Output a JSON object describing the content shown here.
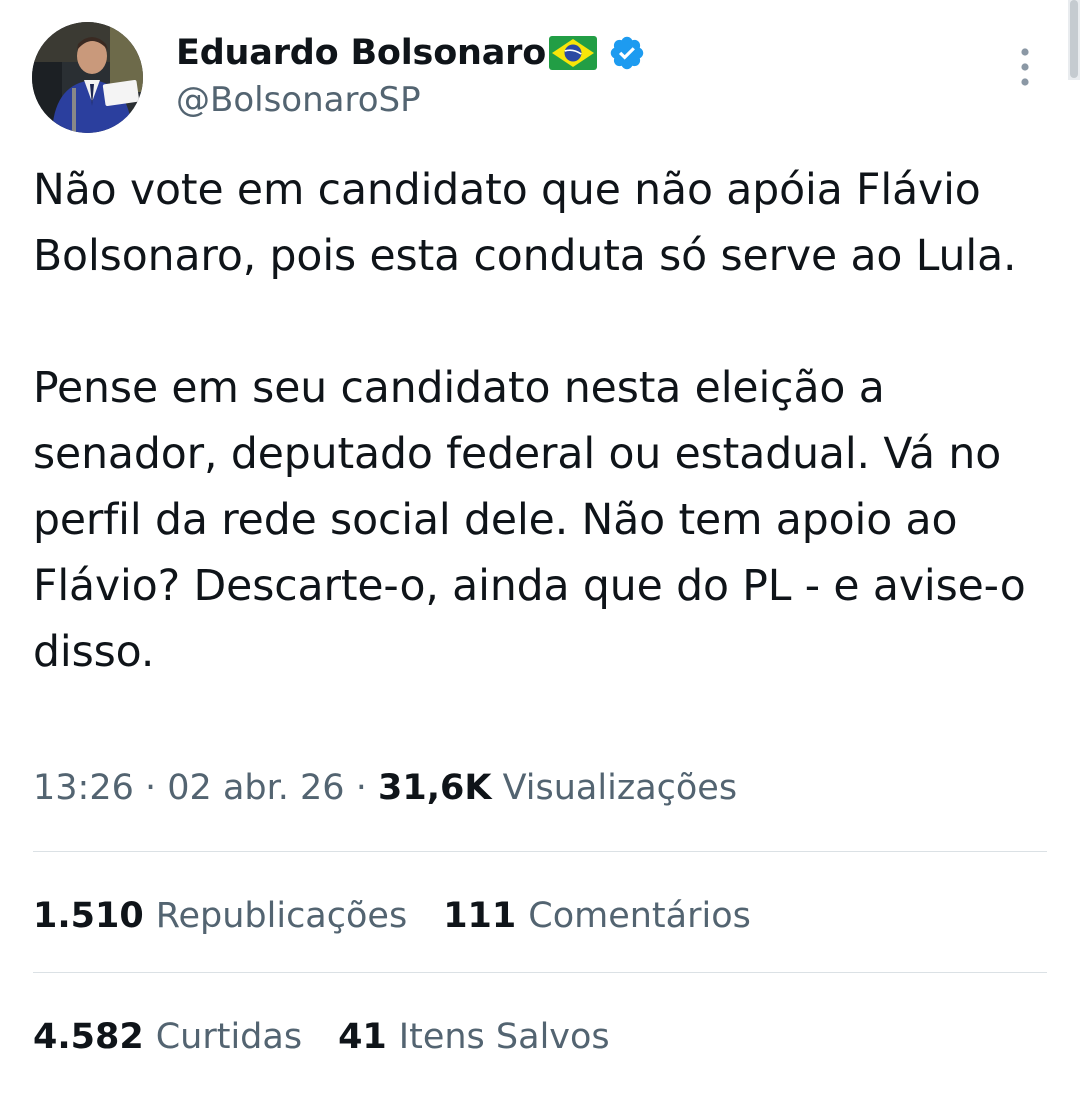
{
  "author": {
    "display_name": "Eduardo Bolsonaro",
    "flag_icon": "brazil-flag-emoji",
    "verified_icon": "verified-badge-icon",
    "handle": "@BolsonaroSP"
  },
  "tweet": {
    "text": "Não vote em candidato que não apóia Flávio Bolsonaro, pois esta conduta só serve ao Lula.\n\nPense em seu candidato nesta eleição a senador, deputado federal ou estadual. Vá no perfil da rede social dele. Não tem apoio ao Flávio? Descarte-o, ainda que do PL - e avise-o disso."
  },
  "meta": {
    "time": "13:26",
    "separator": "·",
    "date": "02 abr. 26",
    "views_count": "31,6K",
    "views_label": "Visualizações"
  },
  "stats": {
    "reposts": {
      "count": "1.510",
      "label": "Republicações"
    },
    "comments": {
      "count": "111",
      "label": "Comentários"
    },
    "likes": {
      "count": "4.582",
      "label": "Curtidas"
    },
    "bookmarks": {
      "count": "41",
      "label": "Itens Salvos"
    }
  },
  "colors": {
    "text_primary": "#0f1419",
    "text_secondary": "#536471",
    "verified_blue": "#1d9bf0",
    "divider": "#dbe1e5"
  }
}
